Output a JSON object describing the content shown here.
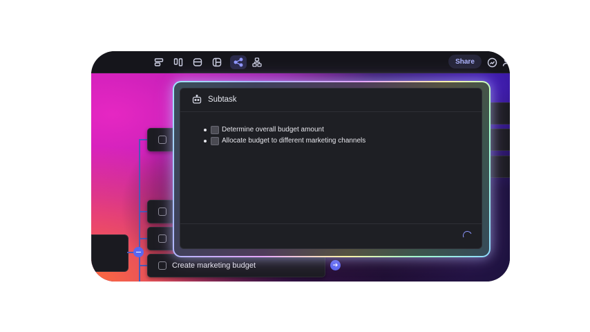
{
  "toolbar": {
    "icons": [
      "list-layout-icon",
      "columns-layout-icon",
      "card-layout-icon",
      "grid-layout-icon",
      "mindmap-icon",
      "org-chart-icon"
    ],
    "share_label": "Share",
    "right_icons": [
      "analytics-icon",
      "user-icon"
    ]
  },
  "colors": {
    "accent": "#5a67f0",
    "panel_bg": "#1e1f24",
    "canvas_dark": "#121217"
  },
  "mindmap": {
    "nodes": [
      {
        "label": ""
      },
      {
        "label": ""
      },
      {
        "label": ""
      },
      {
        "label": "Create marketing budget"
      }
    ]
  },
  "panel": {
    "title": "Subtask",
    "subtasks": [
      {
        "label": "Determine overall budget amount"
      },
      {
        "label": "Allocate budget to different marketing channels"
      }
    ]
  }
}
